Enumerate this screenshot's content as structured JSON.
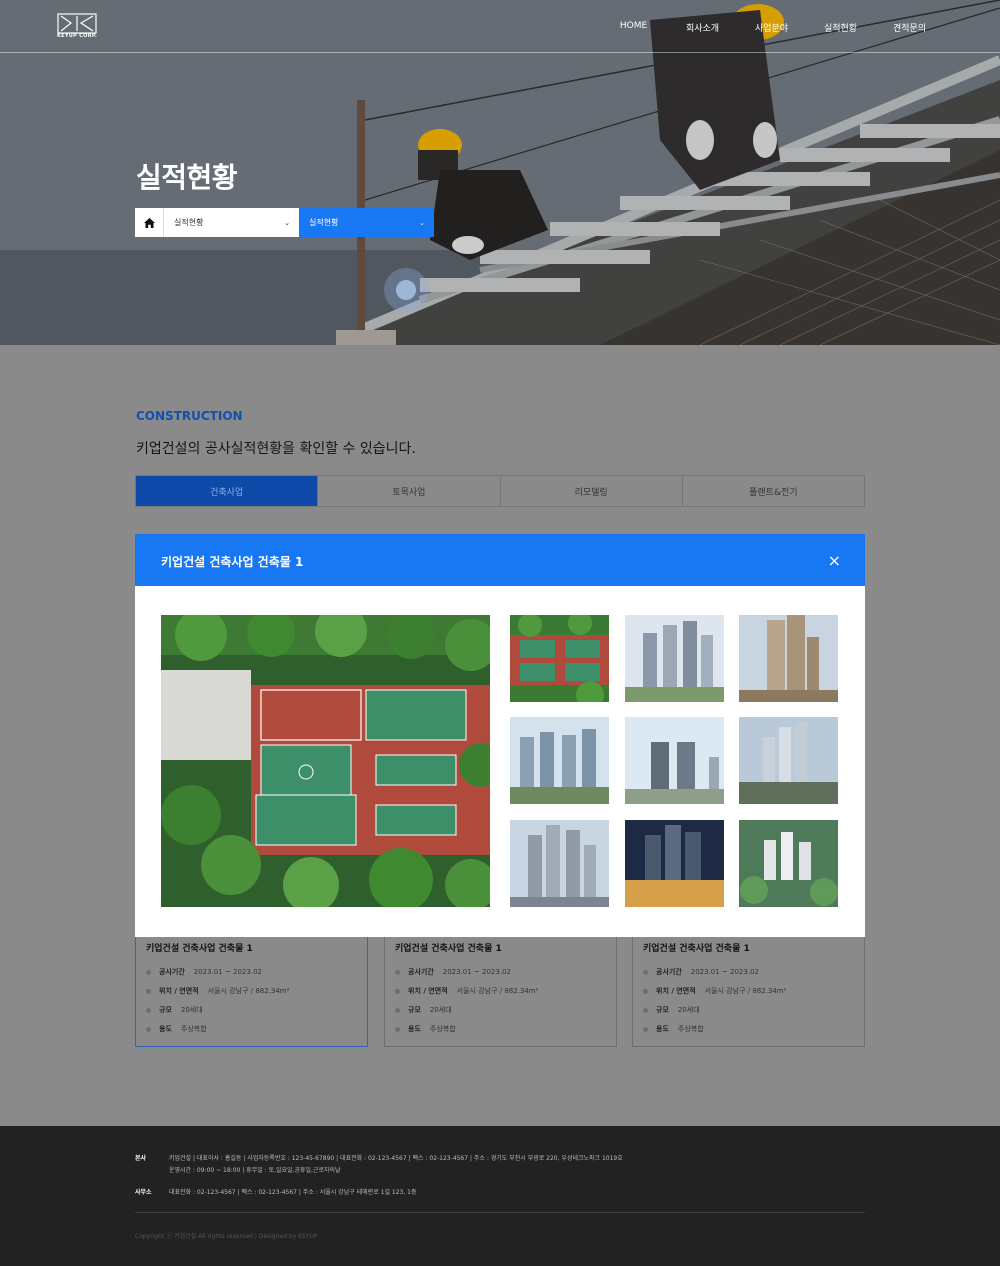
{
  "header": {
    "logo_text": "KEYUP CORP.",
    "nav": [
      "HOME",
      "회사소개",
      "사업분야",
      "실적현황",
      "견적문의"
    ]
  },
  "hero": {
    "title": "실적현황",
    "breadcrumb_1": "실적현황",
    "breadcrumb_2": "실적현황"
  },
  "section": {
    "label": "CONSTRUCTION",
    "description": "키업건설의 공사실적현황을 확인할 수 있습니다."
  },
  "tabs": [
    "건축사업",
    "토목사업",
    "리모델링",
    "플랜트&전기"
  ],
  "modal": {
    "title": "키업건설 건축사업 건축물 1",
    "close_label": "×"
  },
  "cards": [
    {
      "title": "키업건설 건축사업 건축물 1",
      "rows": [
        {
          "k": "공사기간",
          "v": "2023.01 ~ 2023.02"
        },
        {
          "k": "위치 / 연면적",
          "v": "서울시 강남구 / 882.34m²"
        },
        {
          "k": "규모",
          "v": "20세대"
        },
        {
          "k": "용도",
          "v": "주상복합"
        }
      ]
    },
    {
      "title": "키업건설 건축사업 건축물 1",
      "rows": [
        {
          "k": "공사기간",
          "v": "2023.01 ~ 2023.02"
        },
        {
          "k": "위치 / 연면적",
          "v": "서울시 강남구 / 882.34m²"
        },
        {
          "k": "규모",
          "v": "20세대"
        },
        {
          "k": "용도",
          "v": "주상복합"
        }
      ]
    },
    {
      "title": "키업건설 건축사업 건축물 1",
      "rows": [
        {
          "k": "공사기간",
          "v": "2023.01 ~ 2023.02"
        },
        {
          "k": "위치 / 연면적",
          "v": "서울시 강남구 / 882.34m²"
        },
        {
          "k": "규모",
          "v": "20세대"
        },
        {
          "k": "용도",
          "v": "주상복합"
        }
      ]
    }
  ],
  "footer": {
    "hq_label": "본사",
    "hq_line1": "키업건설 | 대표이사 : 홍길동 | 사업자등록번호 : 123-45-67890 | 대표전화 : 02-123-4567 | 팩스 : 02-123-4567 | 주소 : 경기도 부천시 부광로 220, 우성테크노파크 1019호",
    "hq_line2": "운영시간 : 09:00 ~ 18:00 | 휴무일 : 토,일요일,공휴일,근로자의날",
    "office_label": "사무소",
    "office_line": "대표전화 : 02-123-4567 | 팩스 : 02-123-4567 | 주소 : 서울시 강남구 테헤란로 1길 123, 1층",
    "copyright": "Copyright ⓒ 키업건설 All rights reserved | Designed by KEYUP"
  },
  "colors": {
    "accent": "#1877f2",
    "tab_active": "#0f4aa8",
    "label": "#1150b0",
    "footer_bg": "#222222"
  }
}
